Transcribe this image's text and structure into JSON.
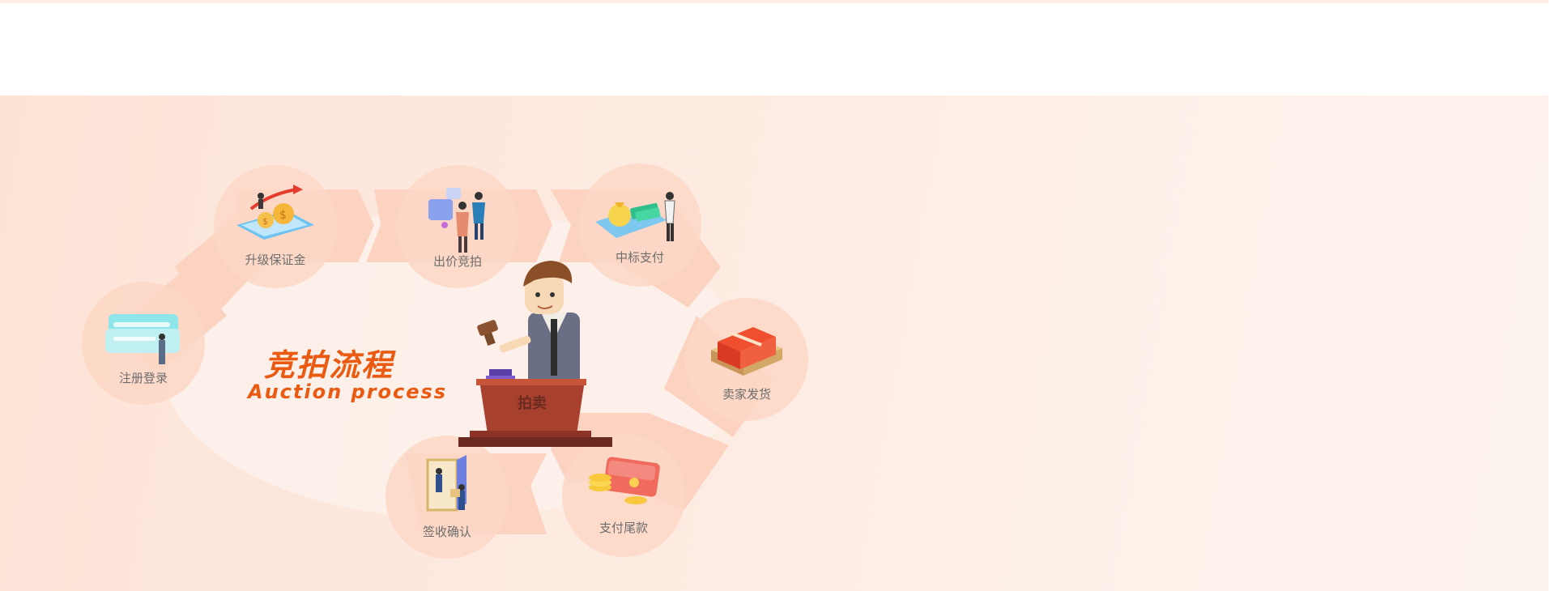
{
  "banner": {
    "title_cn": "竞拍流程",
    "title_en": "Auction process"
  },
  "steps": [
    {
      "label": "注册登录",
      "icon": "register-icon"
    },
    {
      "label": "升级保证金",
      "icon": "deposit-upgrade-icon"
    },
    {
      "label": "出价竞拍",
      "icon": "bidding-icon"
    },
    {
      "label": "中标支付",
      "icon": "winning-payment-icon"
    },
    {
      "label": "卖家发货",
      "icon": "seller-shipping-icon"
    },
    {
      "label": "支付尾款",
      "icon": "final-payment-icon"
    },
    {
      "label": "签收确认",
      "icon": "receipt-confirm-icon"
    }
  ],
  "podium": {
    "label": "拍卖"
  },
  "colors": {
    "accent": "#ea5a10",
    "track": "#fbd0bc",
    "background": "#fde8dd"
  }
}
